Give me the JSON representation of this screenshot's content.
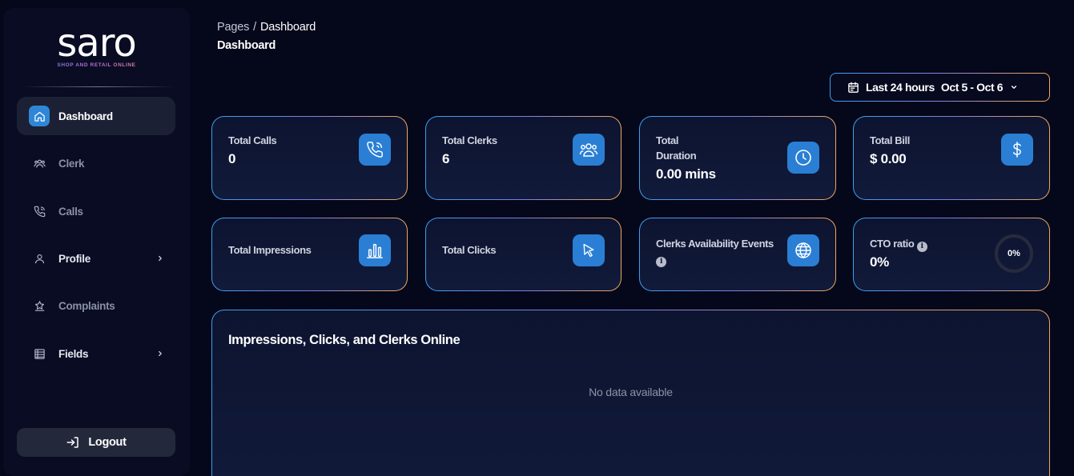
{
  "brand": {
    "name": "saro",
    "tagline": "SHOP AND RETAIL ONLINE"
  },
  "sidebar": {
    "items": [
      {
        "label": "Dashboard",
        "icon": "home-icon",
        "active": true
      },
      {
        "label": "Clerk",
        "icon": "users-icon"
      },
      {
        "label": "Calls",
        "icon": "phone-icon"
      },
      {
        "label": "Profile",
        "icon": "user-icon",
        "has_children": true
      },
      {
        "label": "Complaints",
        "icon": "alert-icon"
      },
      {
        "label": "Fields",
        "icon": "list-icon",
        "has_children": true
      }
    ],
    "logout_label": "Logout"
  },
  "breadcrumb": {
    "root": "Pages",
    "separator": "/",
    "current": "Dashboard"
  },
  "page_title": "Dashboard",
  "date_range": {
    "preset": "Last 24 hours",
    "dates": "Oct 5 - Oct 6"
  },
  "stats": {
    "total_calls": {
      "label": "Total Calls",
      "value": "0",
      "icon": "phone-call-icon"
    },
    "total_clerks": {
      "label": "Total Clerks",
      "value": "6",
      "icon": "users-icon"
    },
    "total_duration": {
      "label_line1": "Total",
      "label_line2": "Duration",
      "value": "0.00 mins",
      "icon": "clock-icon"
    },
    "total_bill": {
      "label": "Total Bill",
      "value": "$ 0.00",
      "icon": "dollar-icon"
    },
    "total_impressions": {
      "label": "Total Impressions",
      "icon": "bar-chart-icon"
    },
    "total_clicks": {
      "label": "Total Clicks",
      "icon": "cursor-icon"
    },
    "clerks_availability": {
      "label": "Clerks Availability Events",
      "icon": "globe-icon"
    },
    "cto_ratio": {
      "label": "CTO ratio",
      "value": "0%",
      "gauge_value": "0%",
      "gauge_fraction": 0
    }
  },
  "chart_panel": {
    "title": "Impressions, Clicks, and Clerks Online",
    "empty_text": "No data available"
  },
  "colors": {
    "accent": "#2f86d6",
    "background": "#05071a",
    "sidebar": "#090c22",
    "border_start": "#3aa0f0",
    "border_end": "#f0a85a"
  }
}
